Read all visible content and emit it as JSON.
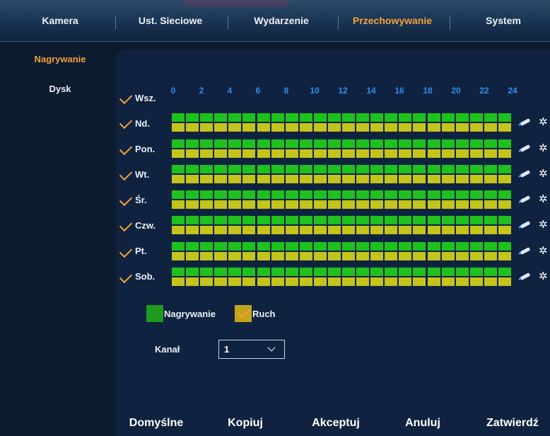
{
  "tabs": [
    {
      "label": "Kamera",
      "active": false
    },
    {
      "label": "Ust. Sieciowe",
      "active": false
    },
    {
      "label": "Wydarzenie",
      "active": false
    },
    {
      "label": "Przechowywanie",
      "active": true
    },
    {
      "label": "System",
      "active": false
    }
  ],
  "sidebar": {
    "items": [
      {
        "label": "Nagrywanie",
        "active": true
      },
      {
        "label": "Dysk",
        "active": false
      }
    ]
  },
  "schedule": {
    "all_label": "Wsz.",
    "hours": [
      "0",
      "2",
      "4",
      "6",
      "8",
      "10",
      "12",
      "14",
      "16",
      "18",
      "20",
      "22",
      "24"
    ],
    "days": [
      {
        "label": "Nd.",
        "checked": true
      },
      {
        "label": "Pon.",
        "checked": true
      },
      {
        "label": "Wt.",
        "checked": true
      },
      {
        "label": "Śr.",
        "checked": true
      },
      {
        "label": "Czw.",
        "checked": true
      },
      {
        "label": "Pt.",
        "checked": true
      },
      {
        "label": "Sob.",
        "checked": true
      }
    ],
    "recording_fraction": 1.0,
    "motion_fraction": 1.0
  },
  "legend": {
    "recording_label": "Nagrywanie",
    "recording_color": "#1e9a1e",
    "motion_label": "Ruch",
    "motion_color": "#c4a41a"
  },
  "channel": {
    "label": "Kanał",
    "value": "1"
  },
  "buttons": {
    "default": "Domyślne",
    "copy": "Kopiuj",
    "accept": "Akceptuj",
    "cancel": "Anuluj",
    "confirm": "Zatwierdź"
  },
  "colors": {
    "accent": "#f2a13a",
    "hour_text": "#2f8df0",
    "record_cell": "#1ec11e",
    "motion_cell": "#c4c41a"
  }
}
